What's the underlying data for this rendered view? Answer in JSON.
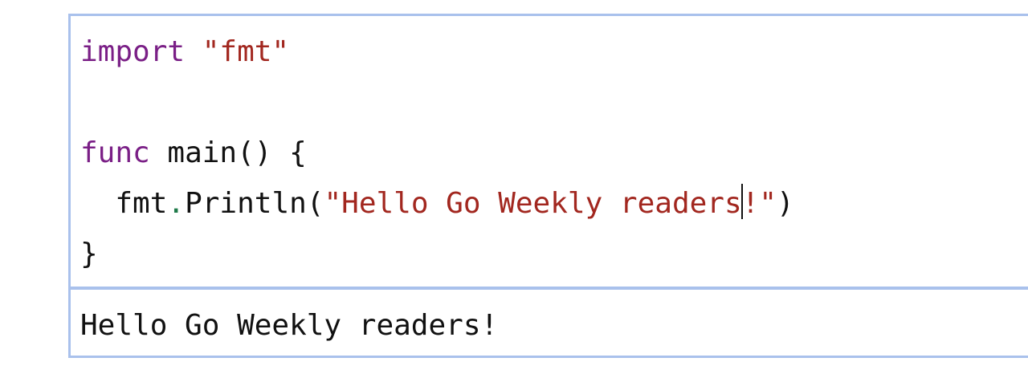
{
  "editor": {
    "line1": {
      "keyword": "import",
      "string": "\"fmt\""
    },
    "line3": {
      "keyword": "func",
      "rest": "main() {"
    },
    "line4": {
      "indent": "  ",
      "pkg": "fmt",
      "dot": ".",
      "func": "Println(",
      "string_before_cursor": "\"Hello Go Weekly readers",
      "string_after_cursor": "!\"",
      "close": ")"
    },
    "line5": {
      "text": "}"
    }
  },
  "output": {
    "text": "Hello Go Weekly readers!"
  },
  "colors": {
    "border": "#a9c1ec",
    "keyword": "#7a1f86",
    "string": "#a2271f",
    "dot": "#1f7a4a",
    "text": "#111111"
  }
}
